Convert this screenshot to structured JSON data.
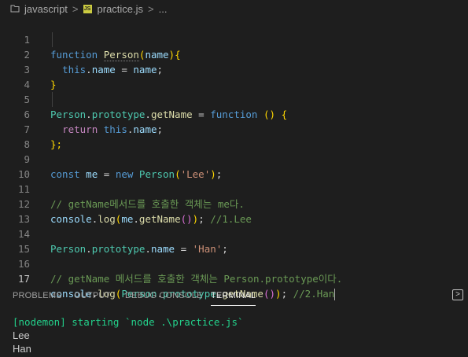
{
  "breadcrumb": {
    "folder": "javascript",
    "separator": ">",
    "file_badge": "JS",
    "file": "practice.js",
    "tail": "..."
  },
  "editor": {
    "line_numbers": [
      "1",
      "2",
      "3",
      "4",
      "5",
      "6",
      "7",
      "8",
      "9",
      "10",
      "11",
      "12",
      "13",
      "14",
      "15",
      "16",
      "17"
    ],
    "tokens": {
      "l1": [
        "function",
        "Person",
        "(",
        "name",
        ")",
        "{"
      ],
      "l2": [
        "this",
        ".",
        "name",
        " = ",
        "name",
        ";"
      ],
      "l3": [
        "}"
      ],
      "l5": [
        "Person",
        ".",
        "prototype",
        ".",
        "getName",
        " = ",
        "function",
        " ",
        "()",
        " ",
        "{"
      ],
      "l6": [
        "return",
        " ",
        "this",
        ".",
        "name",
        ";"
      ],
      "l7": [
        "};"
      ],
      "l9": [
        "const",
        " ",
        "me",
        " = ",
        "new",
        " ",
        "Person",
        "(",
        "'Lee'",
        ")",
        ";"
      ],
      "l11": [
        "// getName메서드를 호출한 객체는 me다."
      ],
      "l12": [
        "console",
        ".",
        "log",
        "(",
        "me",
        ".",
        "getName",
        "()",
        ")",
        "; ",
        "//1.Lee"
      ],
      "l14": [
        "Person",
        ".",
        "prototype",
        ".",
        "name",
        " = ",
        "'Han'",
        ";"
      ],
      "l16": [
        "// getName 메서드를 호출한 객체는 Person.prototype이다."
      ],
      "l17": [
        "console",
        ".",
        "log",
        "(",
        "Person",
        ".",
        "prototype",
        ".",
        "getName",
        "()",
        ")",
        "; ",
        "//2.Han"
      ]
    }
  },
  "panel": {
    "tabs": [
      "PROBLEMS",
      "OUTPUT",
      "DEBUG CONSOLE",
      "TERMINAL"
    ],
    "active_tab": "TERMINAL",
    "maximize_glyph": ">"
  },
  "terminal": {
    "lines": [
      "[nodemon] starting `node .\\practice.js`",
      "Lee",
      "Han"
    ]
  },
  "colors": {
    "background": "#1e1e1e",
    "keyword": "#569cd6",
    "class": "#4ec9b0",
    "function": "#dcdcaa",
    "variable": "#9cdcfe",
    "string": "#ce9178",
    "comment": "#6a9955",
    "terminal_green": "#23d18b"
  }
}
